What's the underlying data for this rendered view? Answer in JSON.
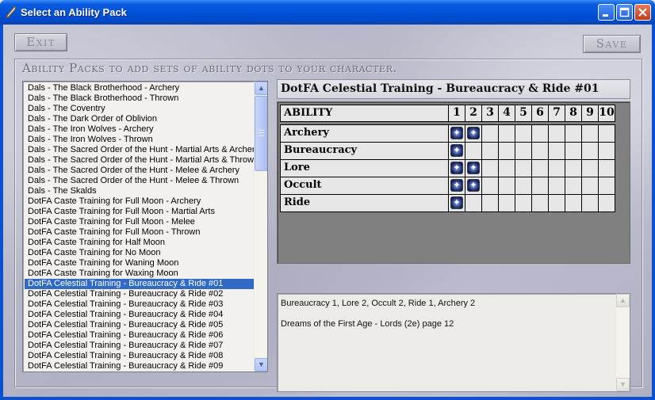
{
  "window": {
    "title": "Select an Ability Pack"
  },
  "toolbar": {
    "exit_label": "Exit",
    "save_label": "Save"
  },
  "group": {
    "title": "Ability Packs to add sets of ability dots to your character."
  },
  "pack_list": {
    "items": [
      "Dals - The Black Brotherhood - Archery",
      "Dals - The Black Brotherhood - Thrown",
      "Dals - The Coventry",
      "Dals - The Dark Order of Oblivion",
      "Dals - The Iron Wolves - Archery",
      "Dals - The Iron Wolves - Thrown",
      "Dals - The Sacred Order of the Hunt - Martial Arts & Archery",
      "Dals - The Sacred Order of the Hunt - Martial Arts & Thrown",
      "Dals - The Sacred Order of the Hunt - Melee & Archery",
      "Dals - The Sacred Order of the Hunt - Melee & Thrown",
      "Dals - The Skalds",
      "DotFA Caste Training for Full Moon - Archery",
      "DotFA Caste Training for Full Moon - Martial Arts",
      "DotFA Caste Training for Full Moon - Melee",
      "DotFA Caste Training for Full Moon - Thrown",
      "DotFA Caste Training for Half Moon",
      "DotFA Caste Training for No Moon",
      "DotFA Caste Training for Waning Moon",
      "DotFA Caste Training for Waxing Moon",
      "DotFA Celestial Training - Bureaucracy & Ride #01",
      "DotFA Celestial Training - Bureaucracy & Ride #02",
      "DotFA Celestial Training - Bureaucracy & Ride #03",
      "DotFA Celestial Training - Bureaucracy & Ride #04",
      "DotFA Celestial Training - Bureaucracy & Ride #05",
      "DotFA Celestial Training - Bureaucracy & Ride #06",
      "DotFA Celestial Training - Bureaucracy & Ride #07",
      "DotFA Celestial Training - Bureaucracy & Ride #08",
      "DotFA Celestial Training - Bureaucracy & Ride #09"
    ],
    "selected_index": 19,
    "scroll_up_glyph": "▲",
    "scroll_down_glyph": "▼"
  },
  "detail": {
    "title": "DotFA Celestial Training - Bureaucracy & Ride #01",
    "grid": {
      "header_label": "ABILITY",
      "columns": [
        "1",
        "2",
        "3",
        "4",
        "5",
        "6",
        "7",
        "8",
        "9",
        "10"
      ],
      "rows": [
        {
          "ability": "Archery",
          "dots": 2
        },
        {
          "ability": "Bureaucracy",
          "dots": 1
        },
        {
          "ability": "Lore",
          "dots": 2
        },
        {
          "ability": "Occult",
          "dots": 2
        },
        {
          "ability": "Ride",
          "dots": 1
        }
      ]
    },
    "description": {
      "line1": "Bureaucracy 1, Lore 2, Occult 2, Ride 1, Archery 2",
      "line2": "Dreams of the First Age - Lords (2e) page 12"
    }
  },
  "colors": {
    "title_bar": "#0052DA",
    "selection": "#316AC5",
    "grid_background": "#808080",
    "cell_background": "#E6E6E6"
  },
  "icons": {
    "app_icon": "quill-icon",
    "minimize": "minimize-icon",
    "maximize": "maximize-icon",
    "close": "close-icon",
    "dot": "star-dot-icon"
  }
}
